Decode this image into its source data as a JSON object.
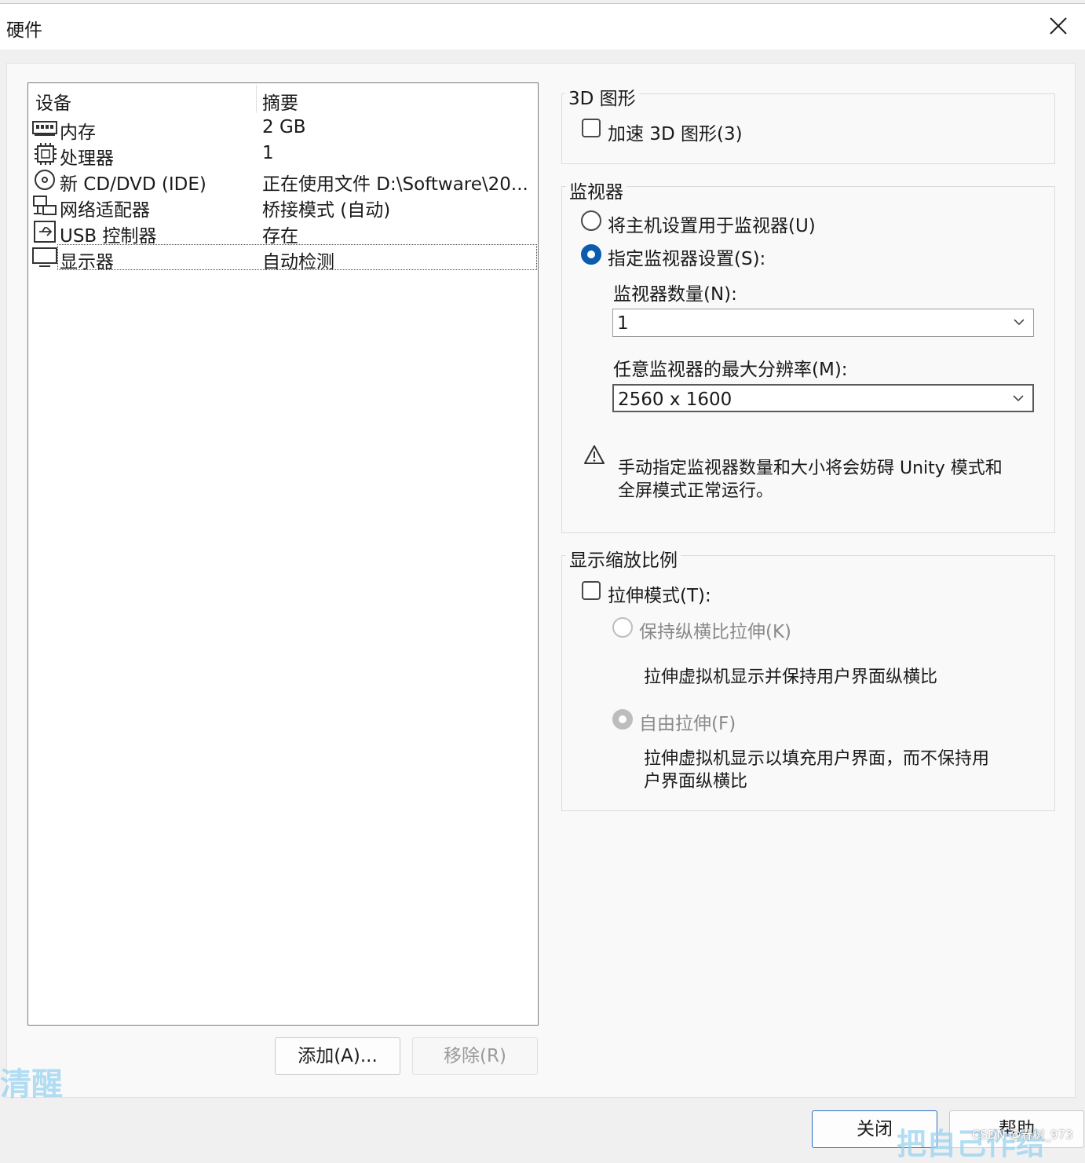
{
  "window": {
    "title": "硬件"
  },
  "device_list": {
    "headers": {
      "device": "设备",
      "summary": "摘要"
    },
    "rows": [
      {
        "name": "内存",
        "summary": "2 GB",
        "icon": "memory-icon"
      },
      {
        "name": "处理器",
        "summary": "1",
        "icon": "processor-icon"
      },
      {
        "name": "新 CD/DVD (IDE)",
        "summary": "正在使用文件 D:\\Software\\20...",
        "icon": "cd-dvd-icon"
      },
      {
        "name": "网络适配器",
        "summary": "桥接模式 (自动)",
        "icon": "network-icon"
      },
      {
        "name": "USB 控制器",
        "summary": "存在",
        "icon": "usb-icon"
      },
      {
        "name": "显示器",
        "summary": "自动检测",
        "icon": "monitor-icon",
        "selected": true
      }
    ]
  },
  "buttons": {
    "add": "添加(A)...",
    "remove": "移除(R)",
    "close": "关闭",
    "help": "帮助"
  },
  "graphics3d": {
    "title": "3D 图形",
    "accelerate_label": "加速 3D 图形(3)",
    "accelerate_checked": false
  },
  "monitor": {
    "title": "监视器",
    "use_host_label": "将主机设置用于监视器(U)",
    "specify_label": "指定监视器设置(S):",
    "selected": "specify",
    "count_label": "监视器数量(N):",
    "count_value": "1",
    "max_res_label": "任意监视器的最大分辨率(M):",
    "max_res_value": "2560 x 1600",
    "warning_line1": "手动指定监视器数量和大小将会妨碍 Unity 模式和",
    "warning_line2": "全屏模式正常运行。"
  },
  "scaling": {
    "title": "显示缩放比例",
    "stretch_label": "拉伸模式(T):",
    "stretch_checked": false,
    "keep_aspect_label": "保持纵横比拉伸(K)",
    "keep_aspect_desc": "拉伸虚拟机显示并保持用户界面纵横比",
    "free_stretch_label": "自由拉伸(F)",
    "free_stretch_desc_line1": "拉伸虚拟机显示以填充用户界面，而不保持用",
    "free_stretch_desc_line2": "户界面纵横比",
    "selected": "free"
  },
  "watermarks": {
    "left": "清醒",
    "bottom_right": "把自己作给",
    "credit": "CSDN @春树_973"
  },
  "colors": {
    "accent": "#0b5cad",
    "watermark": "#99d3f0"
  }
}
